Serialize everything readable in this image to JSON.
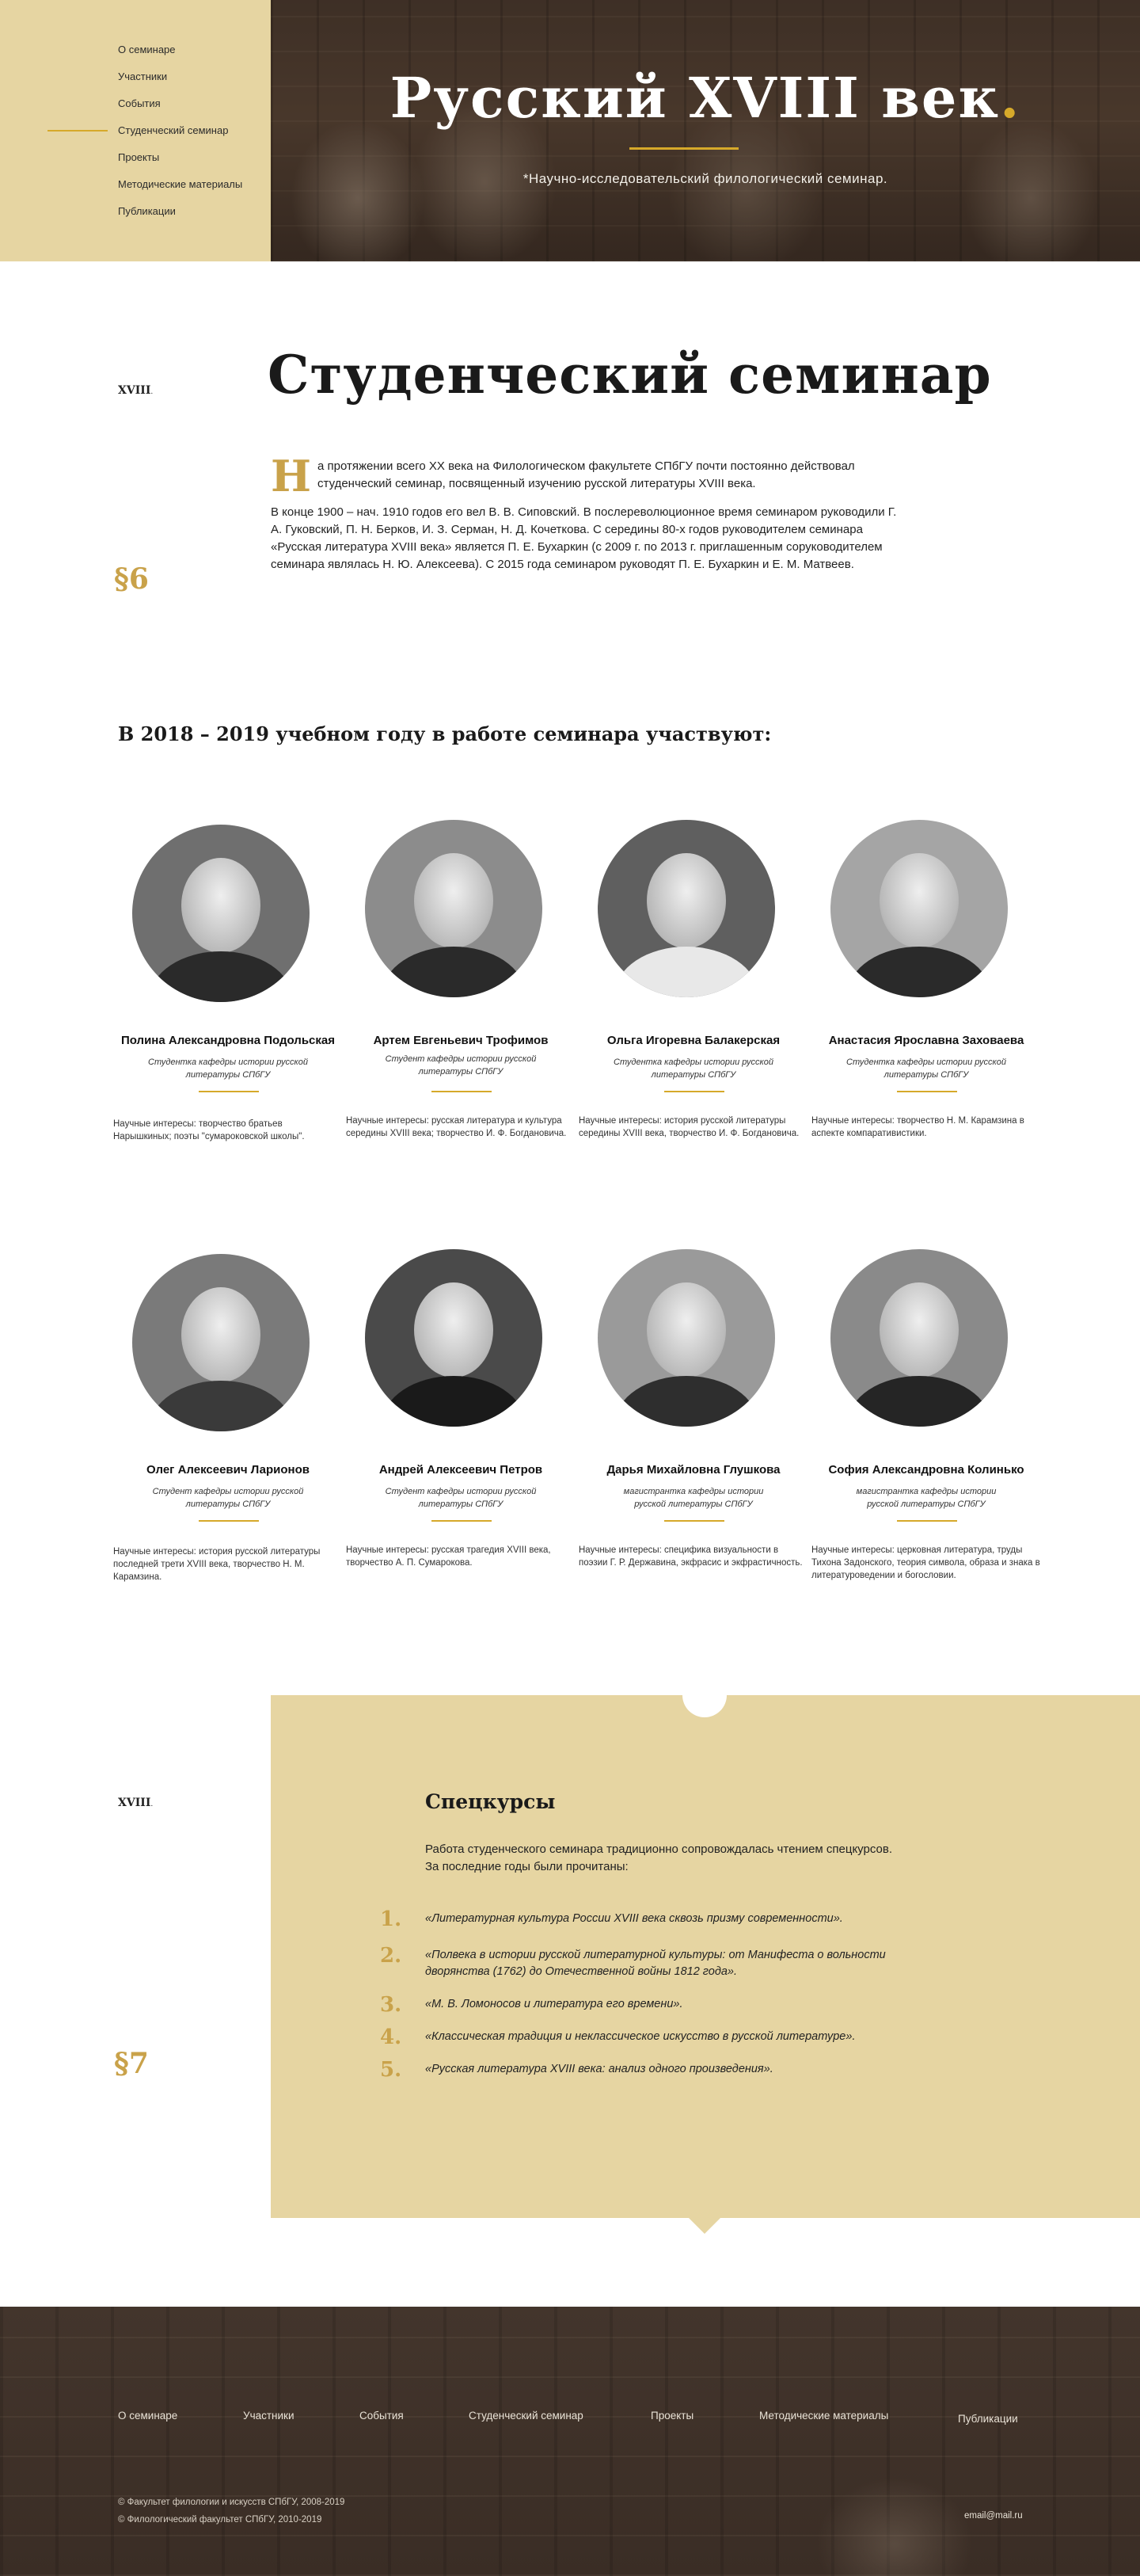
{
  "nav": {
    "items": [
      {
        "label": "О семинаре"
      },
      {
        "label": "Участники"
      },
      {
        "label": "События"
      },
      {
        "label": "Студенческий семинар"
      },
      {
        "label": "Проекты"
      },
      {
        "label": "Методические материалы"
      },
      {
        "label": "Публикации"
      }
    ],
    "active_index": 3
  },
  "hero": {
    "title": "Русский XVIII век",
    "title_dot": ".",
    "subtitle": "*Научно-исследовательский филологический семинар."
  },
  "section6": {
    "side_label": "XVIII",
    "side_label_dot": ".",
    "paragraph_sign": "§6",
    "title": "Студенческий семинар",
    "dropcap": "Н",
    "intro_first": "а протяжении всего XX века на Филологическом факультете СПбГУ почти постоянно действовал студенческий семинар, посвященный изучению русской литературы XVIII века.",
    "intro_second": "В конце 1900 – нач. 1910 годов его вел В. В. Сиповский. В послереволюционное время семинаром руководили Г. А. Гуковский, П. Н. Берков, И. З. Серман, Н. Д. Кочеткова. С середины 80-х годов руководителем семинара «Русская литература XVIII века» является П. Е. Бухаркин (с 2009 г. по 2013 г. приглашенным соруководителем семинара являлась Н. Ю. Алексеева). С 2015 года семинаром руководят П. Е. Бухаркин и Е. М. Матвеев.",
    "participants_heading": "В 2018 – 2019 учебном году в работе семинара участвуют:"
  },
  "people": [
    {
      "name": "Полина Александровна Подольская",
      "role": "Студентка кафедры истории русской литературы СПбГУ",
      "interests": "Научные интересы: творчество братьев Нарышкиных; поэты \"сумароковской школы\"."
    },
    {
      "name": "Артем Евгеньевич Трофимов",
      "role": "Студент кафедры истории русской литературы СПбГУ",
      "interests": "Научные интересы: русская литература и культура середины XVIII века; творчество И. Ф. Богдановича."
    },
    {
      "name": "Ольга Игоревна Балакерская",
      "role": "Студентка кафедры истории русской литературы СПбГУ",
      "interests": "Научные интересы: история русской литературы середины XVIII века, творчество И. Ф. Богдановича."
    },
    {
      "name": "Анастасия Ярославна Заховаева",
      "role": "Студентка кафедры истории русской литературы СПбГУ",
      "interests": "Научные интересы: творчество Н. М. Карамзина в аспекте компаративистики."
    },
    {
      "name": "Олег Алексеевич Ларионов",
      "role": "Студент кафедры истории русской литературы СПбГУ",
      "interests": "Научные интересы: история русской литературы последней трети XVIII века, творчество Н. М. Карамзина."
    },
    {
      "name": "Андрей Алексеевич Петров",
      "role": "Студент кафедры истории русской литературы СПбГУ",
      "interests": "Научные интересы: русская трагедия XVIII века, творчество А. П. Сумарокова."
    },
    {
      "name": "Дарья Михайловна Глушкова",
      "role": "магистрантка кафедры истории русской литературы СПбГУ",
      "interests": "Научные интересы: специфика визуальности в поэзии Г. Р. Державина, экфрасис и экфрастичность."
    },
    {
      "name": "София Александровна Колинько",
      "role": "магистрантка кафедры истории русской литературы СПбГУ",
      "interests": "Научные интересы: церковная литература, труды Тихона Задонского, теория символа, образа и знака в литературоведении и богословии."
    }
  ],
  "section7": {
    "side_label": "XVIII",
    "side_label_dot": ".",
    "paragraph_sign": "§7",
    "title": "Спецкурсы",
    "intro_line1": "Работа студенческого семинара традиционно сопровождалась чтением спецкурсов.",
    "intro_line2": "За последние годы были прочитаны:",
    "courses": [
      {
        "num": "1.",
        "text": "«Литературная культура России XVIII века сквозь призму современности»."
      },
      {
        "num": "2.",
        "text": "«Полвека в истории русской литературной культуры: от Манифеста  о вольности дворянства (1762) до Отечественной войны 1812 года»."
      },
      {
        "num": "3.",
        "text": "«М. В. Ломоносов и литература его времени»."
      },
      {
        "num": "4.",
        "text": "«Классическая традиция и неклассическое искусство в русской литературе»."
      },
      {
        "num": "5.",
        "text": "«Русская литература XVIII века: анализ одного произведения»."
      }
    ]
  },
  "footer": {
    "links": [
      {
        "label": "О семинаре"
      },
      {
        "label": "Участники"
      },
      {
        "label": "События"
      },
      {
        "label": "Студенческий семинар"
      },
      {
        "label": "Проекты"
      },
      {
        "label": "Методические материалы"
      },
      {
        "label": "Публикации"
      }
    ],
    "copyright1": "© Факультет филологии и искусств СПбГУ, 2008-2019",
    "copyright2": "© Филологический факультет СПбГУ, 2010-2019",
    "email": "email@mail.ru"
  },
  "colors": {
    "accent": "#d6a92a",
    "panel": "#e6d5a2",
    "footer": "#3a2d25"
  }
}
